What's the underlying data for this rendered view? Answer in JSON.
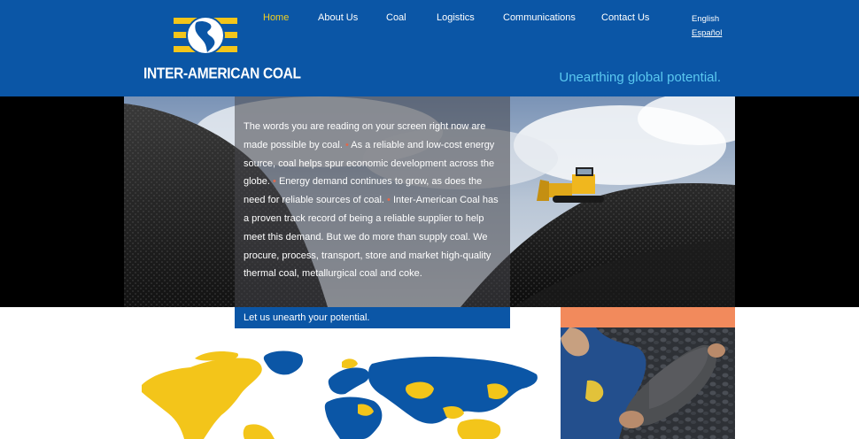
{
  "brand": {
    "name": "INTER-AMERICAN COAL",
    "tagline": "Unearthing global potential."
  },
  "nav": {
    "items": [
      {
        "label": "Home",
        "active": true
      },
      {
        "label": "About Us",
        "active": false
      },
      {
        "label": "Coal",
        "active": false
      },
      {
        "label": "Logistics",
        "active": false
      },
      {
        "label": "Communications",
        "active": false
      },
      {
        "label": "Contact Us",
        "active": false
      }
    ]
  },
  "languages": {
    "english": "English",
    "spanish": "Español"
  },
  "hero": {
    "p1": "The words you are reading on your screen right now are made possible by coal.",
    "p2": "As a reliable and low-cost energy source, coal helps spur economic development across the globe.",
    "p3": "Energy demand continues to grow, as does the need for reliable sources of coal.",
    "p4": "Inter-American Coal has a proven track record of being a reliable supplier to help meet this demand. But we do more than supply coal. We procure, process, transport, store and market high-quality thermal coal, metallurgical coal and coke.",
    "bullet": "•"
  },
  "cta": {
    "label": "Let us unearth your potential."
  },
  "colors": {
    "header_blue": "#0b56a6",
    "nav_active": "#f2cf1f",
    "tagline": "#5ac8f0",
    "map_yellow": "#f3c51a",
    "accent_orange": "#f28a5c"
  }
}
